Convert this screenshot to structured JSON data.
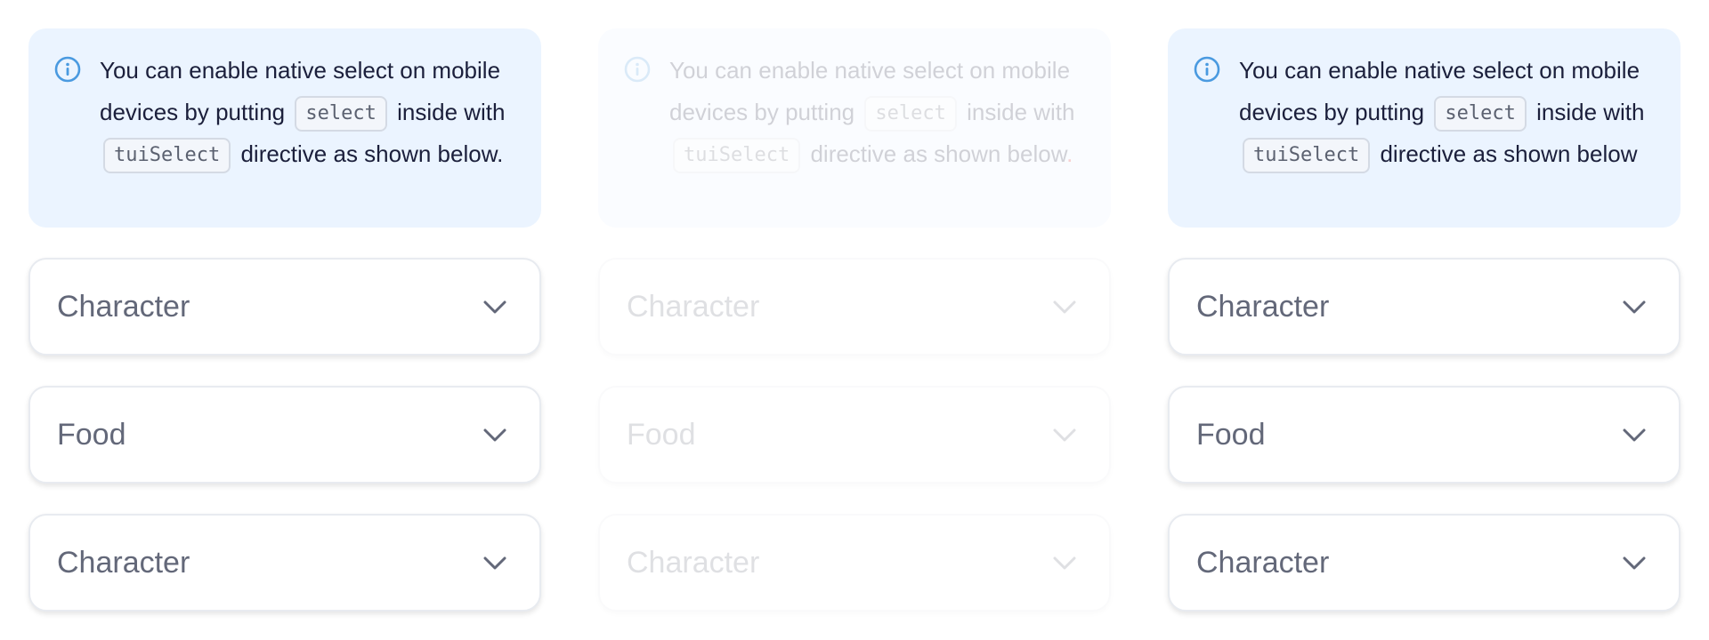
{
  "colors": {
    "accent": "#4a9ae0",
    "notification_background": "#ebf4ff",
    "text_primary": "#1b1f3b",
    "text_secondary": "#636879",
    "highlight": "#e01f1f"
  },
  "panels": [
    {
      "notification": {
        "icon": "info-icon",
        "text_before_select": "You can enable native select on mobile devices by putting",
        "code_select": "select",
        "text_before_directive": "inside with",
        "code_directive": "tuiSelect",
        "text_after_directive": "directive as shown below",
        "period": "."
      },
      "selects": [
        {
          "placeholder": "Character",
          "icon": "chevron-down-icon"
        },
        {
          "placeholder": "Food",
          "icon": "chevron-down-icon"
        },
        {
          "placeholder": "Character",
          "icon": "chevron-down-icon"
        }
      ]
    },
    {
      "notification": {
        "icon": "info-icon",
        "text_before_select": "You can enable native select on mobile devices by putting",
        "code_select": "select",
        "text_before_directive": "inside with",
        "code_directive": "tuiSelect",
        "text_after_directive": "directive as shown below",
        "period": "."
      },
      "selects": [
        {
          "placeholder": "Character",
          "icon": "chevron-down-icon"
        },
        {
          "placeholder": "Food",
          "icon": "chevron-down-icon"
        },
        {
          "placeholder": "Character",
          "icon": "chevron-down-icon"
        }
      ]
    },
    {
      "notification": {
        "icon": "info-icon",
        "text_before_select": "You can enable native select on mobile devices by putting",
        "code_select": "select",
        "text_before_directive": "inside with",
        "code_directive": "tuiSelect",
        "text_after_directive": "directive as shown below",
        "period": ""
      },
      "selects": [
        {
          "placeholder": "Character",
          "icon": "chevron-down-icon"
        },
        {
          "placeholder": "Food",
          "icon": "chevron-down-icon"
        },
        {
          "placeholder": "Character",
          "icon": "chevron-down-icon"
        }
      ]
    }
  ]
}
